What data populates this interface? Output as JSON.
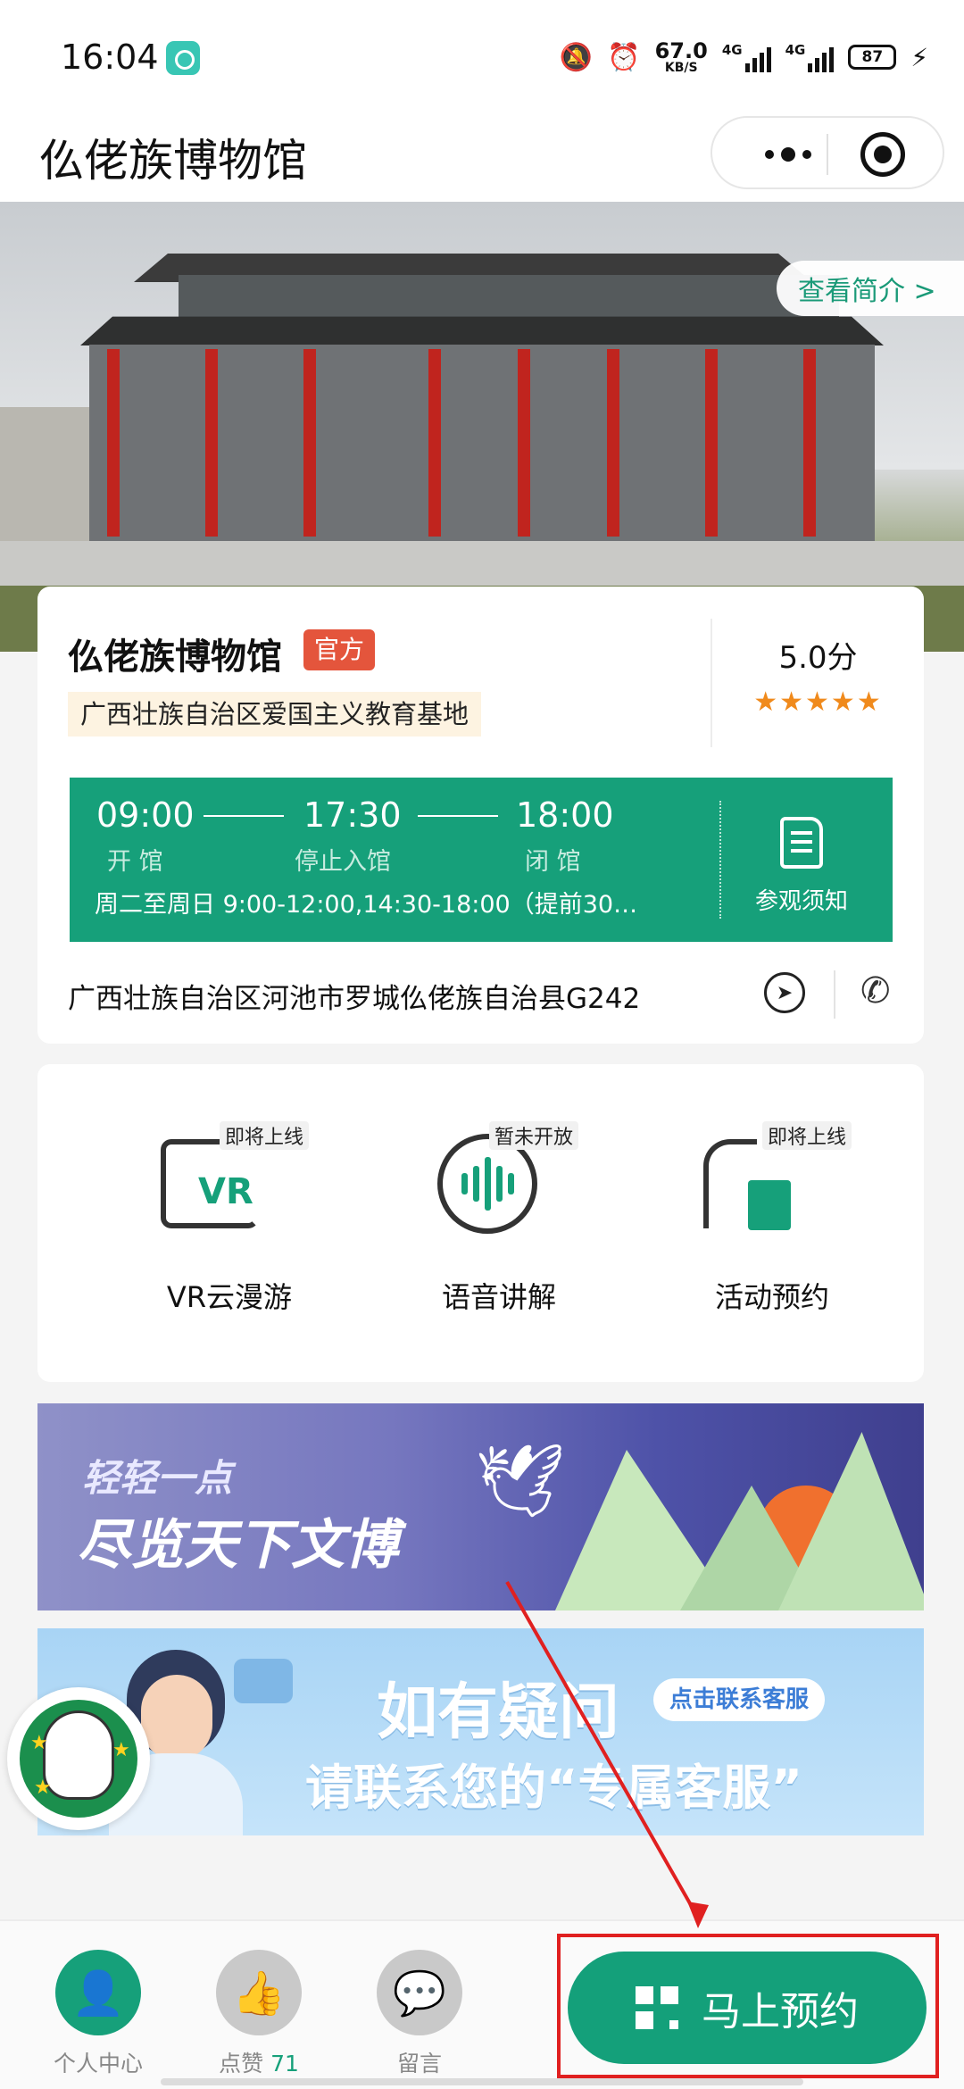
{
  "status_bar": {
    "time": "16:04",
    "net_speed": "67.0",
    "net_unit": "KB/S",
    "signal1": "4G",
    "signal2": "4G",
    "battery": "87"
  },
  "nav": {
    "title": "仫佬族博物馆"
  },
  "hero": {
    "intro_button": "查看简介 >"
  },
  "info": {
    "name": "仫佬族博物馆",
    "official_tag": "官方",
    "honor": "广西壮族自治区爱国主义教育基地",
    "score": "5.0分",
    "stars": "★★★★★",
    "rating_value": 5,
    "hours": {
      "open_time": "09:00",
      "open_label": "开 馆",
      "stop_time": "17:30",
      "stop_label": "停止入馆",
      "close_time": "18:00",
      "close_label": "闭 馆",
      "schedule": "周二至周日 9:00-12:00,14:30-18:00（提前30…",
      "notice_label": "参观须知"
    },
    "address": "广西壮族自治区河池市罗城仫佬族自治县G242"
  },
  "features": [
    {
      "label": "VR云漫游",
      "badge": "即将上线",
      "icon": "vr-icon"
    },
    {
      "label": "语音讲解",
      "badge": "暂未开放",
      "icon": "audio-guide-icon"
    },
    {
      "label": "活动预约",
      "badge": "即将上线",
      "icon": "activity-booking-icon"
    }
  ],
  "banner1": {
    "small": "轻轻一点",
    "big": "尽览天下文博"
  },
  "banner2": {
    "question": "如有疑问",
    "contact_button": "点击联系客服",
    "main": "请联系您的“专属客服”"
  },
  "bottom": {
    "tab_profile": "个人中心",
    "tab_like": "点赞",
    "like_count": "71",
    "tab_message": "留言",
    "cta": "马上预约"
  },
  "colors": {
    "brand_green": "#16a07a",
    "official_red": "#e4553c",
    "star_orange": "#f08a1c",
    "annotation_red": "#e02020"
  }
}
